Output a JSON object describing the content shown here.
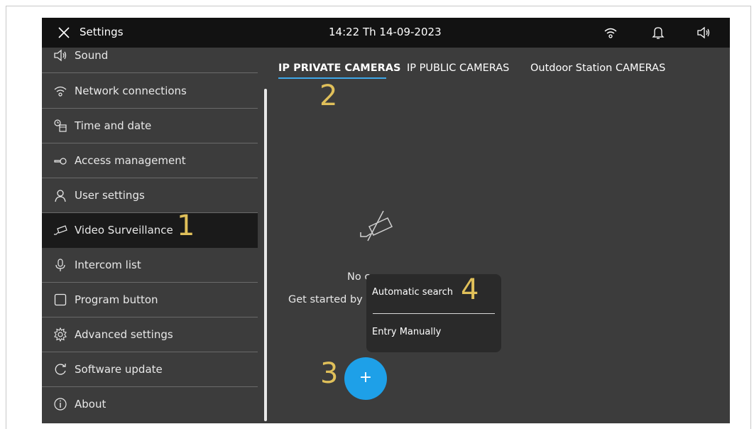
{
  "topbar": {
    "title": "Settings",
    "clock": "14:22  Th 14-09-2023",
    "icons": [
      "close-icon",
      "wifi-icon",
      "bell-icon",
      "speaker-icon"
    ]
  },
  "sidebar": {
    "items": [
      {
        "label": "Sound",
        "icon": "speaker-icon"
      },
      {
        "label": "Network connections",
        "icon": "wifi-icon"
      },
      {
        "label": "Time and date",
        "icon": "clock-calendar-icon"
      },
      {
        "label": "Access  management",
        "icon": "key-icon"
      },
      {
        "label": "User settings",
        "icon": "user-icon"
      },
      {
        "label": "Video Surveillance",
        "icon": "camera-icon",
        "active": true
      },
      {
        "label": "Intercom list",
        "icon": "microphone-icon"
      },
      {
        "label": "Program button",
        "icon": "square-icon"
      },
      {
        "label": "Advanced settings",
        "icon": "gear-icon"
      },
      {
        "label": "Software update",
        "icon": "refresh-icon"
      },
      {
        "label": "About",
        "icon": "info-icon"
      }
    ]
  },
  "tabs": [
    {
      "label": "IP PRIVATE CAMERAS",
      "active": true
    },
    {
      "label": "IP PUBLIC CAMERAS",
      "active": false
    },
    {
      "label": "Outdoor Station CAMERAS",
      "active": false
    }
  ],
  "empty_state": {
    "title": "No c",
    "subtitle": "Get started by a",
    "icon": "camera-off-icon"
  },
  "fab": {
    "label": "+"
  },
  "popup": {
    "options": [
      "Automatic search",
      "Entry Manually"
    ]
  },
  "annotations": [
    "1",
    "2",
    "3",
    "4"
  ],
  "colors": {
    "accent": "#1ea0e8",
    "annotation": "#e0c05a",
    "background": "#3c3c3c",
    "topbar": "#121212"
  }
}
